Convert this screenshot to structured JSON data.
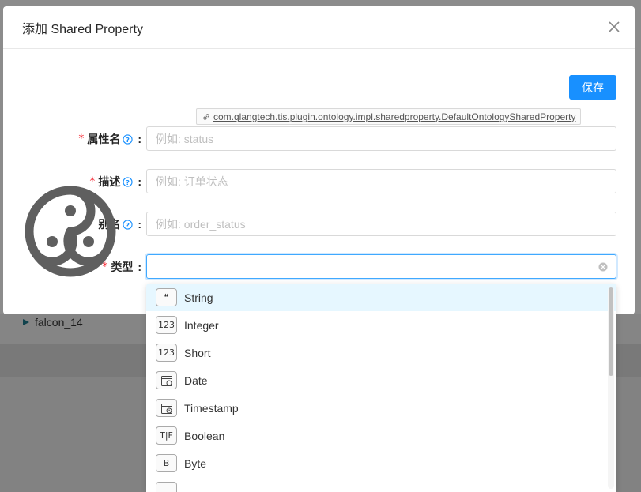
{
  "background": {
    "row_label": "falcon_14"
  },
  "modal": {
    "title": "添加 Shared Property",
    "save_label": "保存",
    "plugin_class": "com.qlangtech.tis.plugin.ontology.impl.sharedproperty.DefaultOntologySharedProperty"
  },
  "fields": {
    "name": {
      "label": "属性名",
      "required": true,
      "placeholder": "例如: status"
    },
    "description": {
      "label": "描述",
      "required": true,
      "placeholder": "例如: 订单状态"
    },
    "alias": {
      "label": "别名",
      "required": false,
      "placeholder": "例如: order_status"
    },
    "type": {
      "label": "类型",
      "required": true,
      "value": ""
    }
  },
  "type_options": [
    {
      "label": "String",
      "icon": "quote-icon",
      "glyph": "❝"
    },
    {
      "label": "Integer",
      "icon": "number-icon",
      "glyph": "123"
    },
    {
      "label": "Short",
      "icon": "number-icon",
      "glyph": "123"
    },
    {
      "label": "Date",
      "icon": "calendar-icon",
      "glyph": ""
    },
    {
      "label": "Timestamp",
      "icon": "calendar-clock-icon",
      "glyph": ""
    },
    {
      "label": "Boolean",
      "icon": "true-false-icon",
      "glyph": "T|F"
    },
    {
      "label": "Byte",
      "icon": "byte-icon",
      "glyph": "B"
    }
  ],
  "colors": {
    "primary": "#1890ff",
    "required": "#f5222d",
    "active_option": "#e6f7ff"
  }
}
